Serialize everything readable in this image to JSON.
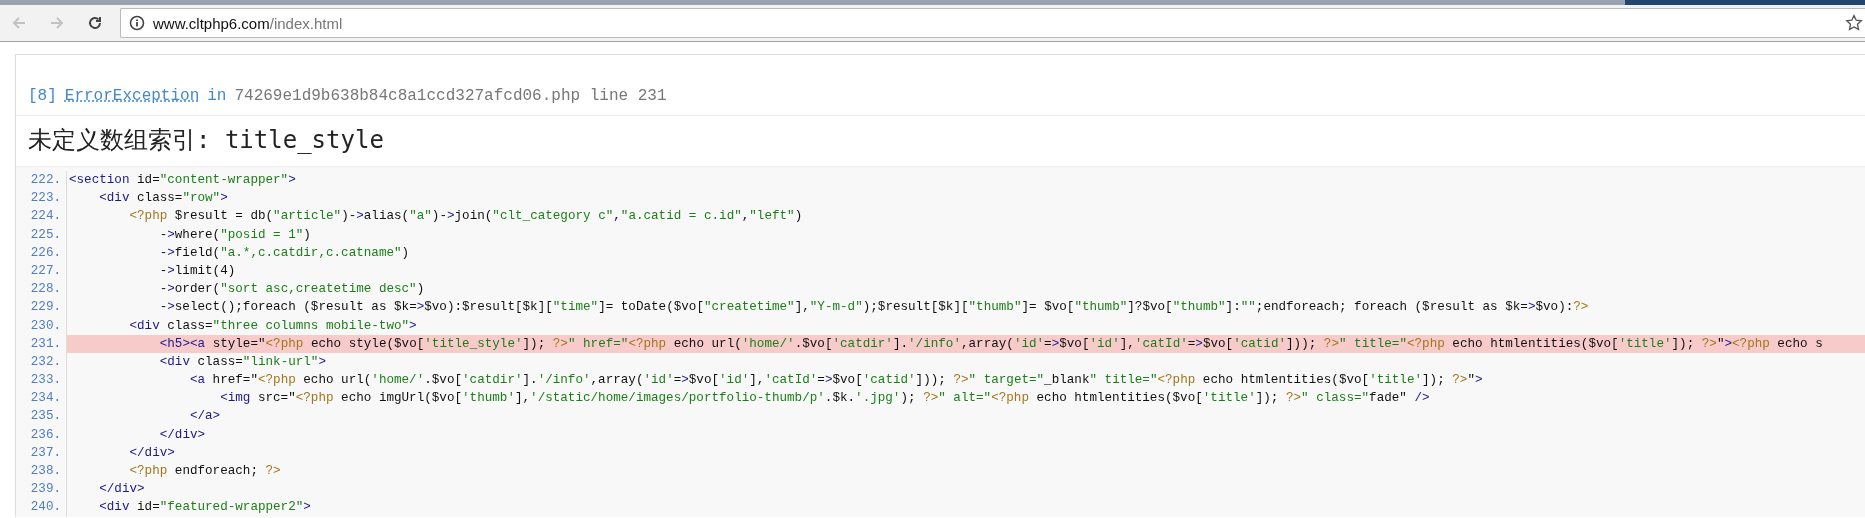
{
  "toolbar": {
    "back": {
      "disabled": true
    },
    "forward": {
      "disabled": true
    },
    "url": {
      "host": "www.cltphp6.com",
      "path": "/index.html"
    }
  },
  "error": {
    "code": "[8]",
    "exception": "ErrorException",
    "connector": "in",
    "location": "74269e1d9b638b84c8a1ccd327afcd06.php line 231",
    "message": "未定义数组索引: title_style"
  },
  "source": {
    "lines": [
      {
        "number": "222.",
        "code": "<section id=\"content-wrapper\">",
        "selected": false
      },
      {
        "number": "223.",
        "code": "    <div class=\"row\">",
        "selected": false
      },
      {
        "number": "224.",
        "code": "        <?php $result = db(\"article\")->alias(\"a\")->join(\"clt_category c\",\"a.catid = c.id\",\"left\")",
        "selected": false
      },
      {
        "number": "225.",
        "code": "            ->where(\"posid = 1\")",
        "selected": false
      },
      {
        "number": "226.",
        "code": "            ->field(\"a.*,c.catdir,c.catname\")",
        "selected": false
      },
      {
        "number": "227.",
        "code": "            ->limit(4)",
        "selected": false
      },
      {
        "number": "228.",
        "code": "            ->order(\"sort asc,createtime desc\")",
        "selected": false
      },
      {
        "number": "229.",
        "code": "            ->select();foreach ($result as $k=>$vo):$result[$k][\"time\"]= toDate($vo[\"createtime\"],\"Y-m-d\");$result[$k][\"thumb\"]= $vo[\"thumb\"]?$vo[\"thumb\"]:\"\";endforeach; foreach ($result as $k=>$vo):?>",
        "selected": false
      },
      {
        "number": "230.",
        "code": "        <div class=\"three columns mobile-two\">",
        "selected": false
      },
      {
        "number": "231.",
        "code": "            <h5><a style=\"<?php echo style($vo['title_style']); ?>\" href=\"<?php echo url('home/'.$vo['catdir'].'/info',array('id'=>$vo['id'],'catId'=>$vo['catid'])); ?>\" title=\"<?php echo htmlentities($vo['title']); ?>\"><?php echo s",
        "selected": true
      },
      {
        "number": "232.",
        "code": "            <div class=\"link-url\">",
        "selected": false
      },
      {
        "number": "233.",
        "code": "                <a href=\"<?php echo url('home/'.$vo['catdir'].'/info',array('id'=>$vo['id'],'catId'=>$vo['catid'])); ?>\" target=\"_blank\" title=\"<?php echo htmlentities($vo['title']); ?>\">",
        "selected": false
      },
      {
        "number": "234.",
        "code": "                    <img src=\"<?php echo imgUrl($vo['thumb'],'/static/home/images/portfolio-thumb/p'.$k.'.jpg'); ?>\" alt=\"<?php echo htmlentities($vo['title']); ?>\" class=\"fade\" />",
        "selected": false
      },
      {
        "number": "235.",
        "code": "                </a>",
        "selected": false
      },
      {
        "number": "236.",
        "code": "            </div>",
        "selected": false
      },
      {
        "number": "237.",
        "code": "        </div>",
        "selected": false
      },
      {
        "number": "238.",
        "code": "        <?php endforeach; ?>",
        "selected": false
      },
      {
        "number": "239.",
        "code": "    </div>",
        "selected": false
      },
      {
        "number": "240.",
        "code": "    <div id=\"featured-wrapper2\">",
        "selected": false
      }
    ]
  }
}
